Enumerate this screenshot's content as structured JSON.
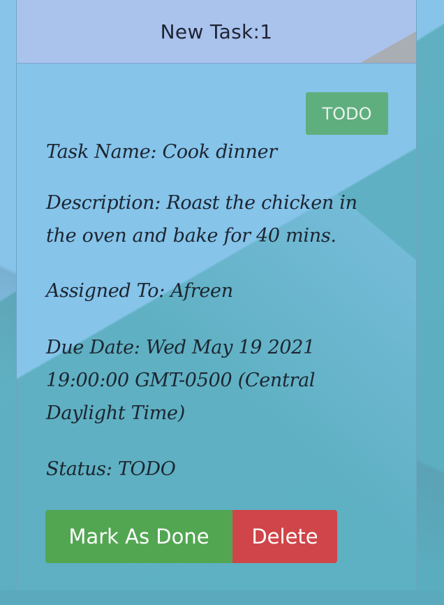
{
  "task_card": {
    "title": "New Task:1",
    "status_badge": "TODO",
    "task_name": "Task Name: Cook dinner",
    "description": "Description: Roast the chicken in the oven and bake for 40 mins.",
    "assigned_to": "Assigned To: Afreen",
    "due_date": "Due Date: Wed May 19 2021 19:00:00 GMT-0500 (Central Daylight Time)",
    "status": "Status: TODO",
    "actions": {
      "mark_done_label": "Mark As Done",
      "delete_label": "Delete"
    }
  },
  "colors": {
    "header_bg": "#aac3ed",
    "badge_bg": "#5fae7d",
    "done_button": "#52a652",
    "delete_button": "#cf4549",
    "background_light": "#86c4ea",
    "background_teal": "#5fb0c2"
  }
}
